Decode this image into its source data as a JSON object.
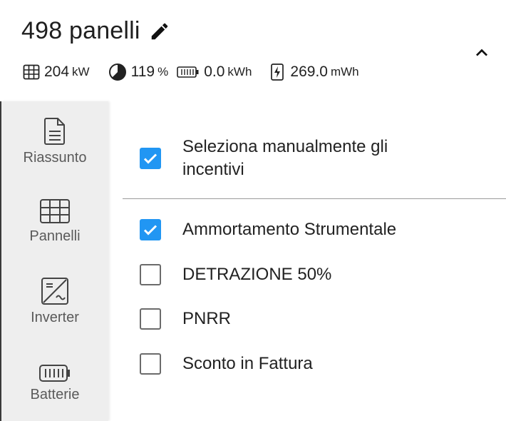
{
  "header": {
    "title": "498 panelli",
    "stats": {
      "power_value": "204",
      "power_unit": "kW",
      "coverage_value": "119",
      "coverage_unit": "%",
      "battery_value": "0.0",
      "battery_unit": "kWh",
      "energy_value": "269.0",
      "energy_unit": "mWh"
    }
  },
  "sidebar": {
    "items": [
      {
        "label": "Riassunto",
        "icon": "document-icon"
      },
      {
        "label": "Pannelli",
        "icon": "grid-icon"
      },
      {
        "label": "Inverter",
        "icon": "inverter-icon"
      },
      {
        "label": "Batterie",
        "icon": "battery-icon"
      }
    ]
  },
  "incentives": {
    "manual_select_label": "Seleziona manualmente gli incentivi",
    "manual_select_checked": true,
    "items": [
      {
        "label": "Ammortamento Strumentale",
        "checked": true
      },
      {
        "label": "DETRAZIONE 50%",
        "checked": false
      },
      {
        "label": "PNRR",
        "checked": false
      },
      {
        "label": "Sconto in Fattura",
        "checked": false
      }
    ]
  },
  "colors": {
    "accent": "#2196f3",
    "sidebar_bg": "#eeeeee"
  }
}
